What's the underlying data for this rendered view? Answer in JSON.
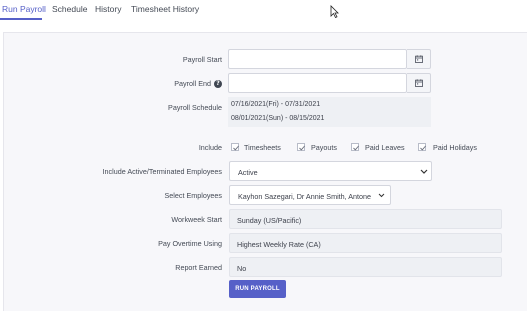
{
  "tabs": [
    {
      "label": "Run Payroll",
      "active": true
    },
    {
      "label": "Schedule",
      "active": false
    },
    {
      "label": "History",
      "active": false
    },
    {
      "label": "Timesheet History",
      "active": false
    }
  ],
  "form": {
    "payroll_start": {
      "label": "Payroll Start",
      "value": ""
    },
    "payroll_end": {
      "label": "Payroll End",
      "value": ""
    },
    "payroll_schedule": {
      "label": "Payroll Schedule",
      "lines": [
        "07/16/2021(Fri) - 07/31/2021",
        "08/01/2021(Sun) - 08/15/2021"
      ]
    },
    "include": {
      "label": "Include",
      "options": [
        {
          "label": "Timesheets",
          "checked": true
        },
        {
          "label": "Payouts",
          "checked": true
        },
        {
          "label": "Paid Leaves",
          "checked": true
        },
        {
          "label": "Paid Holidays",
          "checked": true
        }
      ]
    },
    "active_terminated": {
      "label": "Include Active/Terminated Employees",
      "value": "Active"
    },
    "select_employees": {
      "label": "Select Employees",
      "value": "Kayhon Sazegari, Dr Annie Smith, Antone"
    },
    "workweek_start": {
      "label": "Workweek Start",
      "value": "Sunday (US/Pacific)"
    },
    "pay_overtime": {
      "label": "Pay Overtime Using",
      "value": "Highest Weekly Rate (CA)"
    },
    "report_earned": {
      "label": "Report Earned",
      "value": "No"
    },
    "run_button": "RUN PAYROLL"
  },
  "colors": {
    "accent": "#5660c8",
    "panel_bg": "#f7f7fa",
    "readonly_bg": "#eef0f4"
  },
  "icons": {
    "calendar": "calendar-icon",
    "info": "question-circle-icon",
    "chevron": "chevron-down-icon",
    "check": "check-icon",
    "cursor": "mouse-cursor-icon"
  }
}
